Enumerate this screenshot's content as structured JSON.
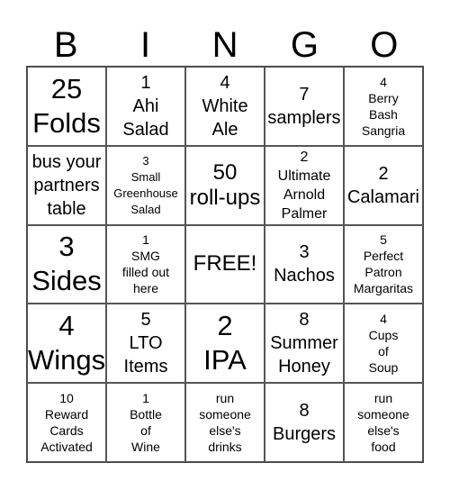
{
  "header": [
    "B",
    "I",
    "N",
    "G",
    "O"
  ],
  "cells": [
    {
      "text": "25\nFolds",
      "size": "s-xl"
    },
    {
      "text": "1\nAhi\nSalad",
      "size": "s-md"
    },
    {
      "text": "4\nWhite\nAle",
      "size": "s-md"
    },
    {
      "text": "7\nsamplers",
      "size": "s-md"
    },
    {
      "text": "4\nBerry\nBash\nSangria",
      "size": "s-xs"
    },
    {
      "text": "bus your\npartners\ntable",
      "size": "s-md"
    },
    {
      "text": "3\nSmall\nGreenhouse\nSalad",
      "size": "s-xxs"
    },
    {
      "text": "50\nroll-ups",
      "size": "s-lg"
    },
    {
      "text": "2\nUltimate\nArnold\nPalmer",
      "size": "s-sm"
    },
    {
      "text": "2\nCalamari",
      "size": "s-md"
    },
    {
      "text": "3\nSides",
      "size": "s-xl"
    },
    {
      "text": "1\nSMG\nfilled out\nhere",
      "size": "s-xs"
    },
    {
      "text": "FREE!",
      "size": "s-lg"
    },
    {
      "text": "3\nNachos",
      "size": "s-md"
    },
    {
      "text": "5\nPerfect\nPatron\nMargaritas",
      "size": "s-xs"
    },
    {
      "text": "4\nWings",
      "size": "s-xl"
    },
    {
      "text": "5\nLTO\nItems",
      "size": "s-md"
    },
    {
      "text": "2\nIPA",
      "size": "s-xl"
    },
    {
      "text": "8\nSummer\nHoney",
      "size": "s-md"
    },
    {
      "text": "4\nCups\nof\nSoup",
      "size": "s-xs"
    },
    {
      "text": "10\nReward\nCards\nActivated",
      "size": "s-xs"
    },
    {
      "text": "1\nBottle\nof\nWine",
      "size": "s-xs"
    },
    {
      "text": "run\nsomeone\nelse's\ndrinks",
      "size": "s-xs"
    },
    {
      "text": "8\nBurgers",
      "size": "s-md"
    },
    {
      "text": "run\nsomeone\nelse's\nfood",
      "size": "s-xs"
    }
  ]
}
